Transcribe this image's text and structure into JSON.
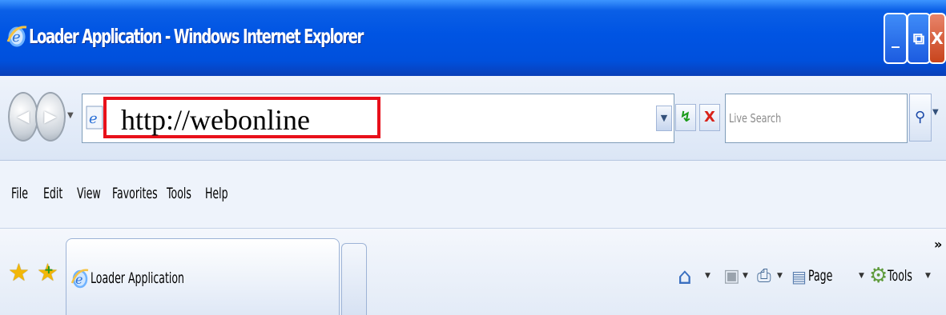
{
  "window": {
    "title": "Loader Application - Windows Internet Explorer",
    "buttons": {
      "minimize": "_",
      "maximize": "⧉",
      "close": "X"
    },
    "titlebar_color": "#0054e3"
  },
  "navigation": {
    "back_icon": "back-arrow-icon",
    "forward_icon": "forward-arrow-icon",
    "address_value": "http://webonline",
    "highlight_color": "#e8101a",
    "refresh_glyph": "↯",
    "stop_glyph": "X",
    "search_placeholder": "Live Search",
    "search_glyph": "⚲"
  },
  "menu": {
    "items": [
      "File",
      "Edit",
      "View",
      "Favorites",
      "Tools",
      "Help"
    ]
  },
  "tabs": {
    "active_tab_label": "Loader Application"
  },
  "commands": {
    "page_label": "Page",
    "tools_label": "Tools",
    "more_glyph": "»"
  }
}
